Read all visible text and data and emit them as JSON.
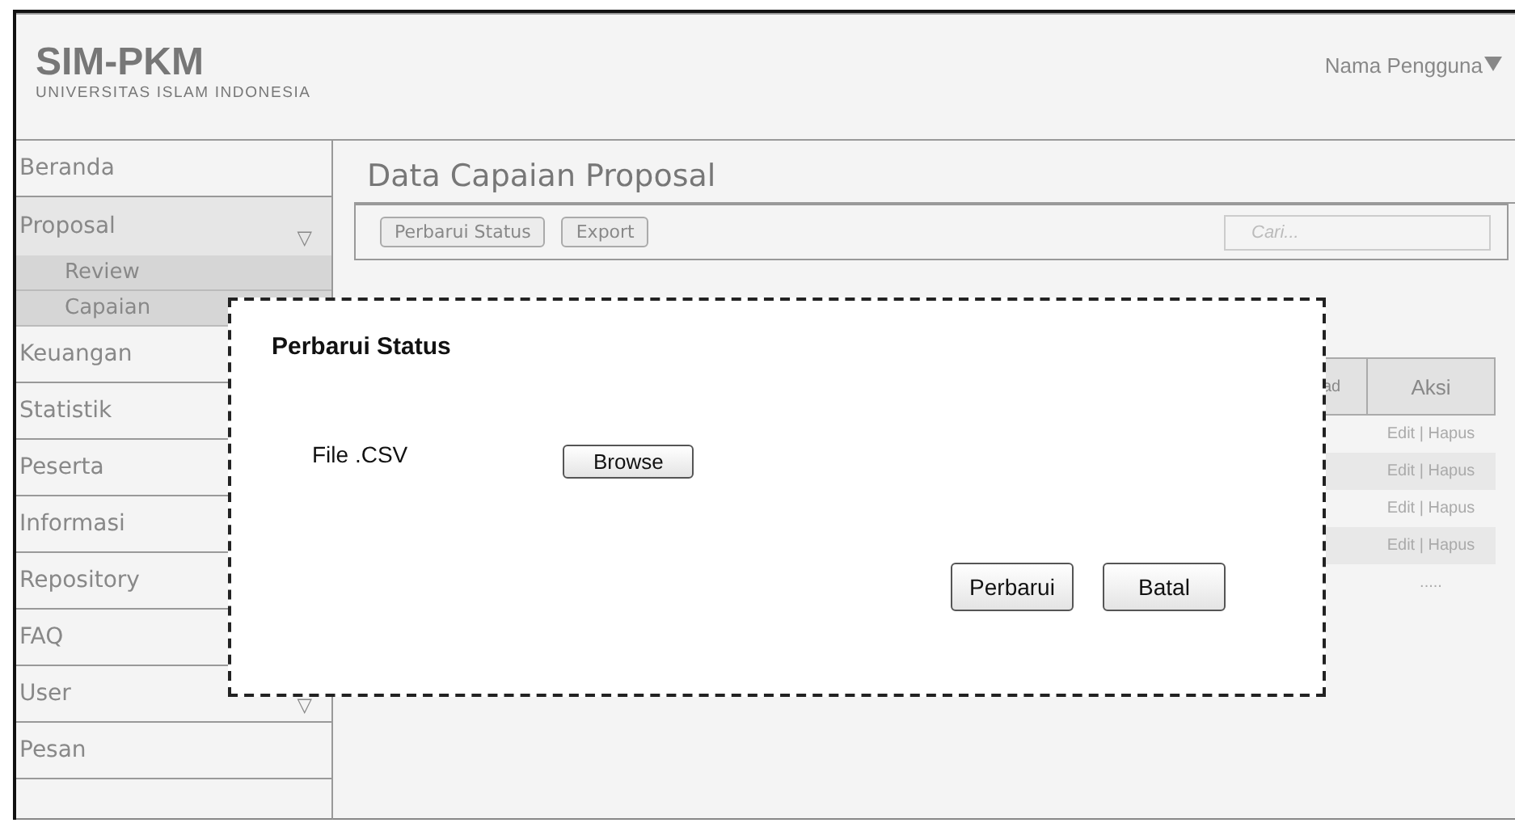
{
  "header": {
    "logo": "SIM-PKM",
    "subtitle": "UNIVERSITAS ISLAM INDONESIA",
    "user_menu": "Nama Pengguna"
  },
  "sidebar": {
    "items": [
      {
        "label": "Beranda"
      },
      {
        "label": "Proposal",
        "toggle": "▽",
        "expanded": true,
        "children": [
          {
            "label": "Review"
          },
          {
            "label": "Capaian"
          }
        ]
      },
      {
        "label": "Keuangan"
      },
      {
        "label": "Statistik"
      },
      {
        "label": "Peserta"
      },
      {
        "label": "Informasi"
      },
      {
        "label": "Repository"
      },
      {
        "label": "FAQ"
      },
      {
        "label": "User",
        "toggle": "▽",
        "expanded": false
      },
      {
        "label": "Pesan"
      }
    ]
  },
  "page": {
    "title": "Data Capaian Proposal",
    "buttons": [
      "Perbarui Status",
      "Export"
    ],
    "search": {
      "placeholder": "Cari..."
    }
  },
  "table": {
    "columns": [
      "ad",
      "Aksi"
    ],
    "rows": [
      {
        "aksi": "Edit | Hapus"
      },
      {
        "aksi": "Edit | Hapus"
      },
      {
        "aksi": "Edit | Hapus"
      },
      {
        "aksi": "Edit | Hapus"
      },
      {
        "aksi": "....."
      }
    ]
  },
  "dialog": {
    "title": "Perbarui Status",
    "field_label": "File .CSV",
    "browse_button": "Browse",
    "buttons": [
      "Perbarui",
      "Batal"
    ]
  }
}
